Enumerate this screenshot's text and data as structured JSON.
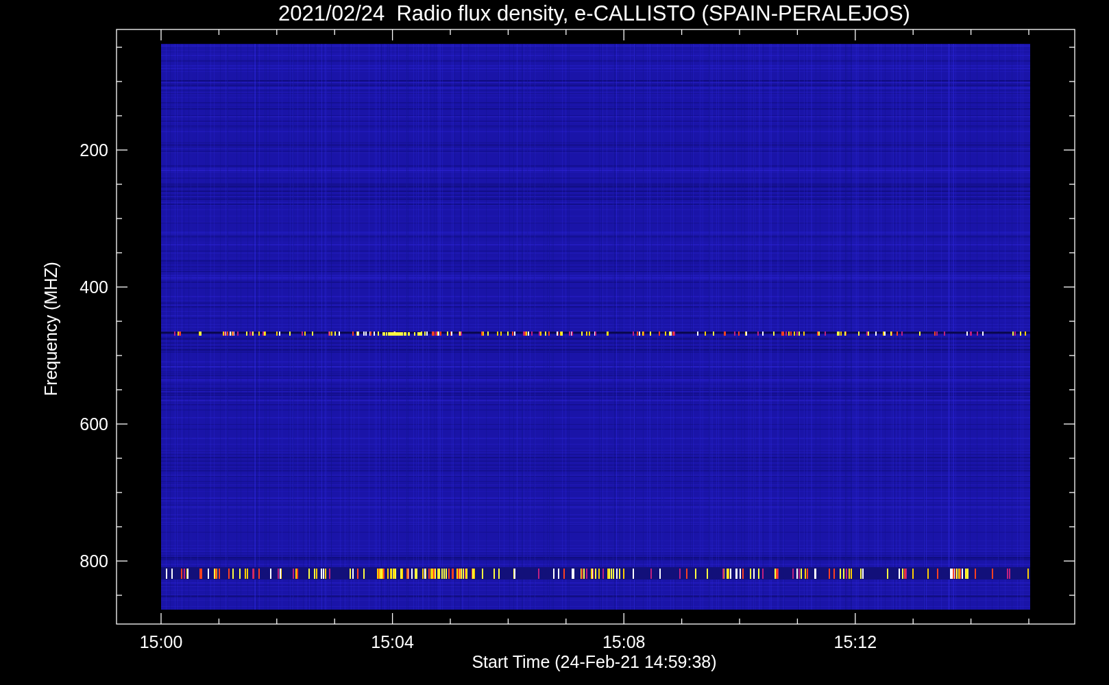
{
  "title": "2021/02/24  Radio flux density, e-CALLISTO (SPAIN-PERALEJOS)",
  "y_axis": {
    "label": "Frequency (MHZ)",
    "tick_labels": [
      "200",
      "400",
      "600",
      "800"
    ]
  },
  "x_axis": {
    "label": "Start Time (24-Feb-21 14:59:38)",
    "tick_labels": [
      "15:00",
      "15:04",
      "15:08",
      "15:12"
    ]
  }
}
